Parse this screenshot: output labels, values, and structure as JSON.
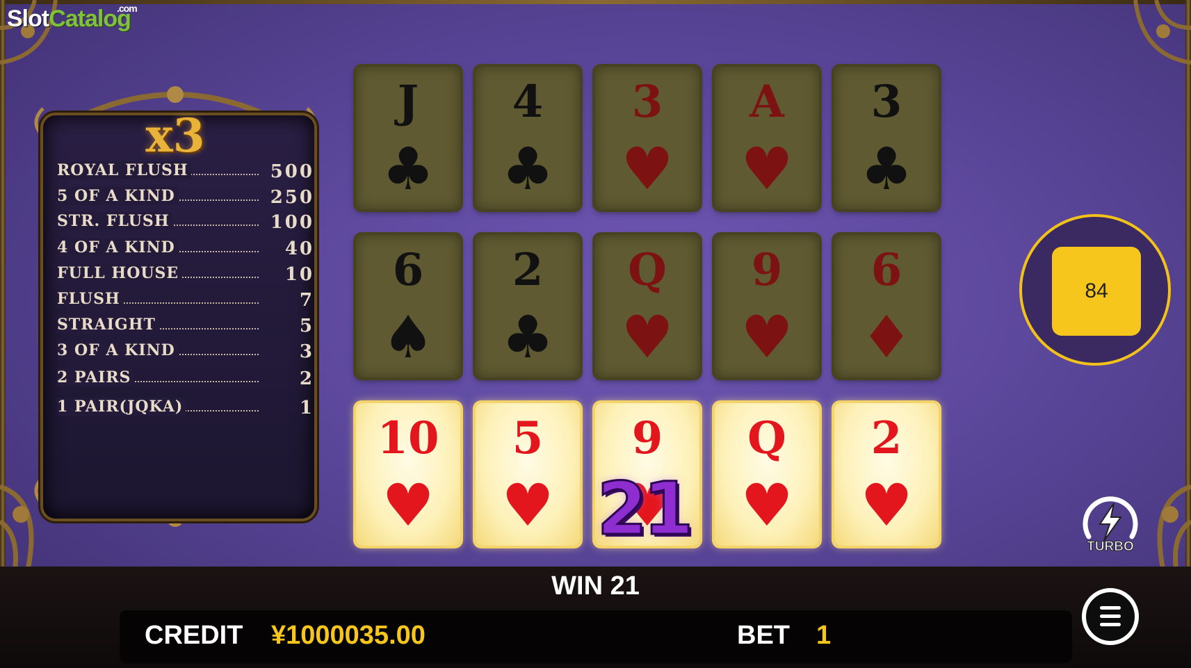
{
  "watermark": {
    "part1": "Slot",
    "part2": "Catalog",
    "suffix": ".com"
  },
  "paytable": {
    "multiplier": "x3",
    "rows": [
      {
        "hand": "ROYAL FLUSH",
        "pay": "500"
      },
      {
        "hand": "5 OF A KIND",
        "pay": "250"
      },
      {
        "hand": "STR. FLUSH",
        "pay": "100"
      },
      {
        "hand": "4 OF A KIND",
        "pay": "40"
      },
      {
        "hand": "FULL HOUSE",
        "pay": "10"
      },
      {
        "hand": "FLUSH",
        "pay": "7"
      },
      {
        "hand": "STRAIGHT",
        "pay": "5"
      },
      {
        "hand": "3 OF A KIND",
        "pay": "3"
      },
      {
        "hand": "2 PAIRS",
        "pay": "2"
      },
      {
        "hand": "1 PAIR(JQKA)",
        "pay": "1"
      }
    ]
  },
  "hands": [
    {
      "cards": [
        {
          "rank": "J",
          "suit": "clubs",
          "symbol": "♣",
          "color": "black"
        },
        {
          "rank": "4",
          "suit": "clubs",
          "symbol": "♣",
          "color": "black"
        },
        {
          "rank": "3",
          "suit": "hearts",
          "symbol": "♥",
          "color": "red"
        },
        {
          "rank": "A",
          "suit": "hearts",
          "symbol": "♥",
          "color": "red"
        },
        {
          "rank": "3",
          "suit": "clubs",
          "symbol": "♣",
          "color": "black"
        }
      ],
      "highlighted": false
    },
    {
      "cards": [
        {
          "rank": "6",
          "suit": "spades",
          "symbol": "♠",
          "color": "black"
        },
        {
          "rank": "2",
          "suit": "clubs",
          "symbol": "♣",
          "color": "black"
        },
        {
          "rank": "Q",
          "suit": "hearts",
          "symbol": "♥",
          "color": "red"
        },
        {
          "rank": "9",
          "suit": "hearts",
          "symbol": "♥",
          "color": "red"
        },
        {
          "rank": "6",
          "suit": "diamonds",
          "symbol": "♦",
          "color": "red"
        }
      ],
      "highlighted": false
    },
    {
      "cards": [
        {
          "rank": "10",
          "suit": "hearts",
          "symbol": "♥",
          "color": "red"
        },
        {
          "rank": "5",
          "suit": "hearts",
          "symbol": "♥",
          "color": "red"
        },
        {
          "rank": "9",
          "suit": "hearts",
          "symbol": "♥",
          "color": "red"
        },
        {
          "rank": "Q",
          "suit": "hearts",
          "symbol": "♥",
          "color": "red"
        },
        {
          "rank": "2",
          "suit": "hearts",
          "symbol": "♥",
          "color": "red"
        }
      ],
      "highlighted": true
    }
  ],
  "win_popup": "21",
  "auto_button": {
    "label": "84"
  },
  "turbo": {
    "label": "TURBO",
    "icon": "lightning-icon"
  },
  "status": {
    "win_text": "WIN 21",
    "credit_label": "CREDIT",
    "credit_value": "¥1000035.00",
    "bet_label": "BET",
    "bet_value": "1"
  },
  "menu": {
    "icon": "menu-icon"
  },
  "colors": {
    "accent": "#f7c61c",
    "background": "#5a4699",
    "win_purple": "#8e2ed1",
    "card_dim": "#5f5a31",
    "card_lit": "#fdf1b8"
  }
}
